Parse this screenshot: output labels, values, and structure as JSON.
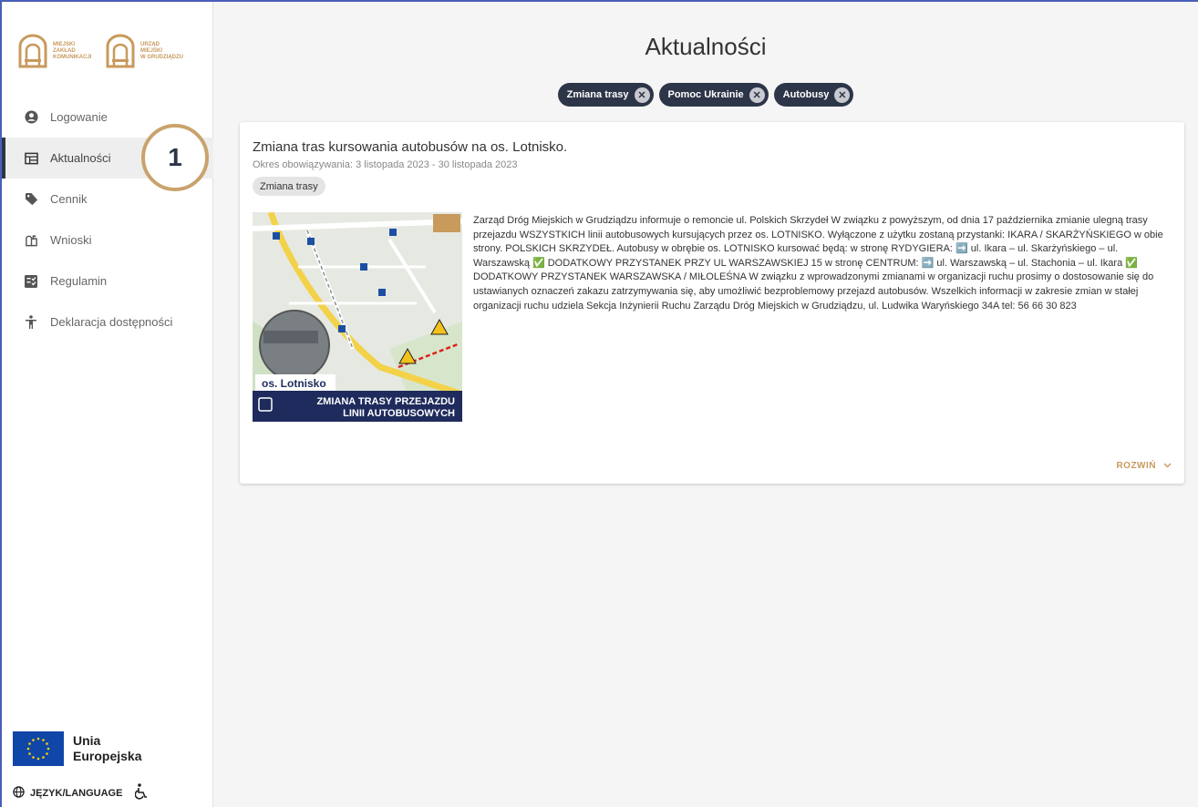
{
  "brand": {
    "logo1_lines": [
      "MIEJSKI",
      "ZAKŁAD",
      "KOMUNIKACJI"
    ],
    "logo2_lines": [
      "URZĄD",
      "MIEJSKI",
      "W GRUDZIĄDZU"
    ],
    "accent": "#c89a5c"
  },
  "sidebar": {
    "items": [
      {
        "label": "Logowanie",
        "icon": "account-circle-icon"
      },
      {
        "label": "Aktualności",
        "icon": "newspaper-icon",
        "active": true
      },
      {
        "label": "Cennik",
        "icon": "tag-icon"
      },
      {
        "label": "Wnioski",
        "icon": "mailbox-icon"
      },
      {
        "label": "Regulamin",
        "icon": "checklist-icon"
      },
      {
        "label": "Deklaracja dostępności",
        "icon": "accessibility-icon"
      }
    ],
    "callout_number": "1",
    "eu_line1": "Unia",
    "eu_line2": "Europejska",
    "language_label": "JĘZYK/LANGUAGE"
  },
  "main": {
    "title": "Aktualności",
    "filters": [
      "Zmiana trasy",
      "Pomoc Ukrainie",
      "Autobusy"
    ],
    "article": {
      "title": "Zmiana tras kursowania autobusów na os. Lotnisko.",
      "validity": "Okres obowiązywania: 3 listopada 2023 - 30 listopada 2023",
      "tag": "Zmiana trasy",
      "thumb_caption": "os. Lotnisko",
      "thumb_banner_line1": "ZMIANA TRASY PRZEJAZDU",
      "thumb_banner_line2": "LINII AUTOBUSOWYCH",
      "body": " Zarząd Dróg Miejskich w Grudziądzu informuje o remoncie ul. Polskich Skrzydeł W związku z powyższym, od dnia 17 października zmianie ulegną trasy przejazdu WSZYSTKICH linii autobusowych kursujących przez os. LOTNISKO. Wyłączone z użytku zostaną przystanki: IKARA / SKARŻYŃSKIEGO w obie strony. POLSKICH SKRZYDEŁ. Autobusy w obrębie os. LOTNISKO kursować będą: w stronę RYDYGIERA: ➡️ ul. Ikara – ul. Skarżyńskiego – ul. Warszawską ✅ DODATKOWY PRZYSTANEK PRZY UL WARSZAWSKIEJ 15 w stronę CENTRUM: ➡️ ul. Warszawską – ul. Stachonia – ul. Ikara ✅ DODATKOWY PRZYSTANEK WARSZAWSKA / MIŁOLEŚNA W związku z wprowadzonymi zmianami w organizacji ruchu prosimy o dostosowanie się do ustawianych oznaczeń zakazu zatrzymywania się, aby umożliwić bezproblemowy przejazd autobusów. Wszelkich informacji w zakresie zmian w stałej organizacji ruchu udziela Sekcja Inżynierii Ruchu Zarządu Dróg Miejskich w Grudziądzu, ul. Ludwika Waryńskiego 34A tel: 56 66 30 823",
      "expand_label": "ROZWIŃ"
    }
  }
}
